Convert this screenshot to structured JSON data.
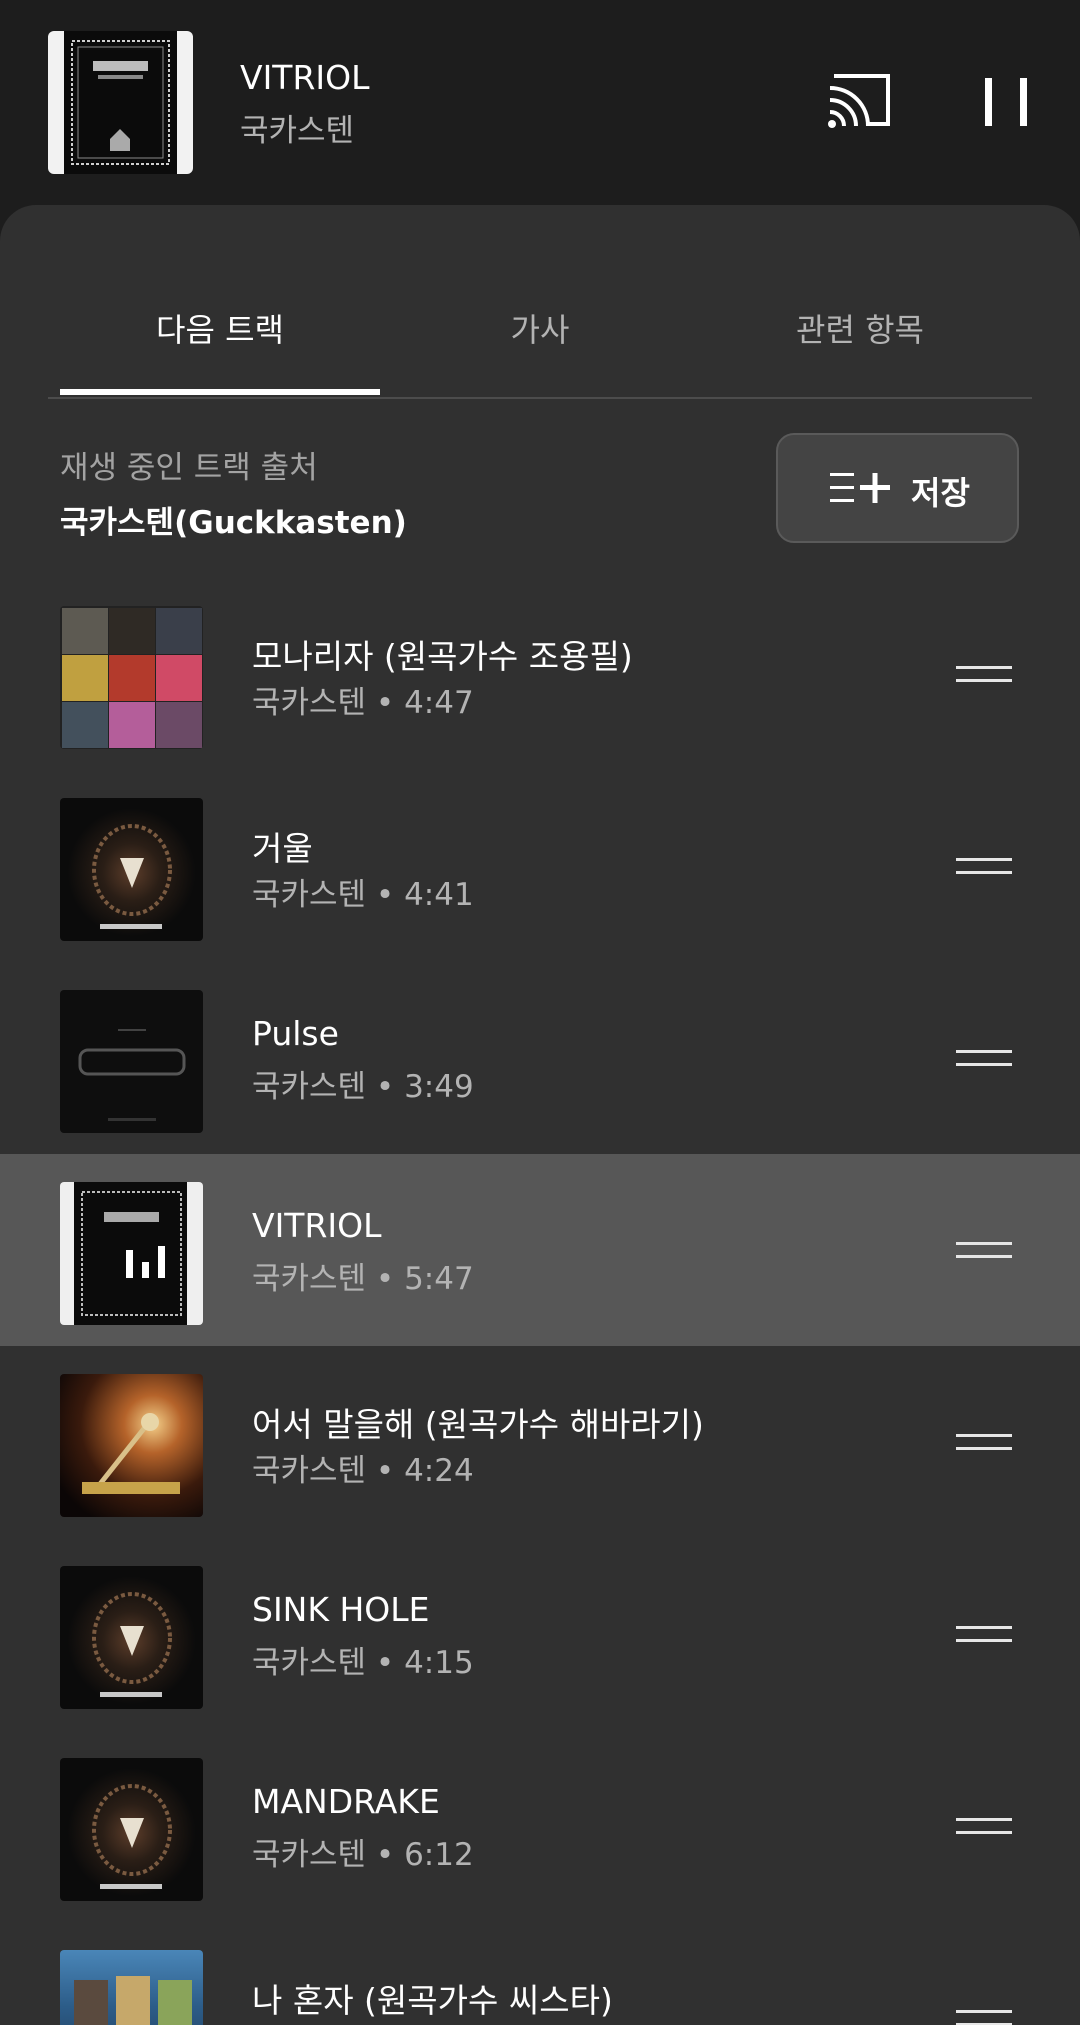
{
  "mini_player": {
    "title": "VITRIOL",
    "artist": "국카스텐",
    "cast_icon": "cast-icon",
    "pause_icon": "pause-icon"
  },
  "tabs": [
    {
      "label": "다음 트랙",
      "active": true
    },
    {
      "label": "가사",
      "active": false
    },
    {
      "label": "관련 항목",
      "active": false
    }
  ],
  "source": {
    "label": "재생 중인 트랙 출처",
    "name": "국카스텐(Guckkasten)"
  },
  "save_button": {
    "label": "저장",
    "icon": "playlist-add-icon"
  },
  "queue": [
    {
      "title": "모나리자 (원곡가수 조용필)",
      "subtitle": "국카스텐 • 4:47",
      "playing": false
    },
    {
      "title": "거울",
      "subtitle": "국카스텐 • 4:41",
      "playing": false
    },
    {
      "title": "Pulse",
      "subtitle": "국카스텐 • 3:49",
      "playing": false
    },
    {
      "title": "VITRIOL",
      "subtitle": "국카스텐 • 5:47",
      "playing": true
    },
    {
      "title": "어서 말을해 (원곡가수 해바라기)",
      "subtitle": "국카스텐 • 4:24",
      "playing": false
    },
    {
      "title": "SINK HOLE",
      "subtitle": "국카스텐 • 4:15",
      "playing": false
    },
    {
      "title": "MANDRAKE",
      "subtitle": "국카스텐 • 6:12",
      "playing": false
    },
    {
      "title": "나 혼자 (원곡가수 씨스타)",
      "subtitle": "",
      "playing": false
    }
  ],
  "colors": {
    "background": "#1d1d1d",
    "sheet": "#303030",
    "playing_row": "#575757",
    "secondary_text": "#b3b3b3"
  }
}
